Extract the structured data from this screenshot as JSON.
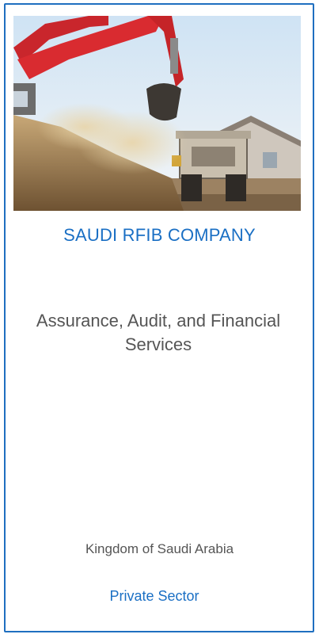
{
  "card": {
    "image_alt": "",
    "company_name": "SAUDI RFIB COMPANY",
    "service": "Assurance, Audit, and Financial Services",
    "country": "Kingdom of Saudi Arabia",
    "sector": "Private Sector"
  },
  "colors": {
    "border": "#1f6fc0",
    "accent": "#1a6fc4",
    "text": "#555555"
  }
}
